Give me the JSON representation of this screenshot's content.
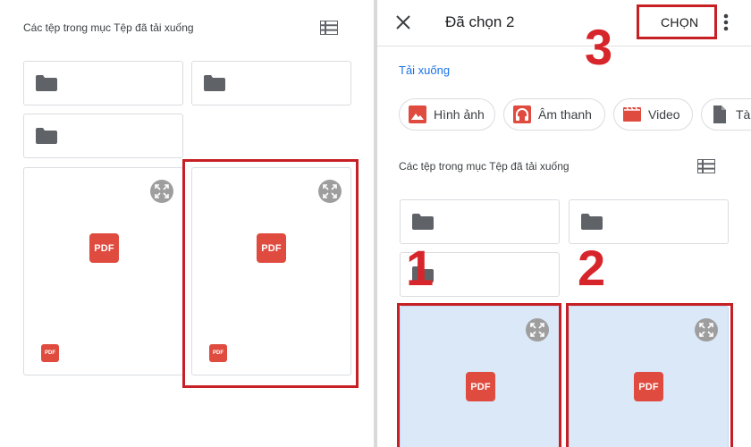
{
  "left_panel": {
    "section_label": "Các tệp trong mục Tệp đã tải xuống"
  },
  "right_panel": {
    "header": {
      "title": "Đã chọn 2",
      "select_button": "CHỌN"
    },
    "breadcrumb": "Tải xuống",
    "chips": [
      {
        "label": "Hình ảnh",
        "icon": "image-icon"
      },
      {
        "label": "Âm thanh",
        "icon": "headphones-icon"
      },
      {
        "label": "Video",
        "icon": "video-icon"
      },
      {
        "label": "Tà",
        "icon": "document-icon"
      }
    ],
    "section_label": "Các tệp trong mục Tệp đã tải xuống"
  },
  "file_badge": "PDF",
  "annotations": {
    "step1": "1",
    "step2": "2",
    "step3": "3"
  },
  "colors": {
    "pdf_red": "#e04b3f",
    "annotation_red": "#c62024",
    "selected_bg": "#dbe8f8",
    "link_blue": "#1a73e8"
  }
}
